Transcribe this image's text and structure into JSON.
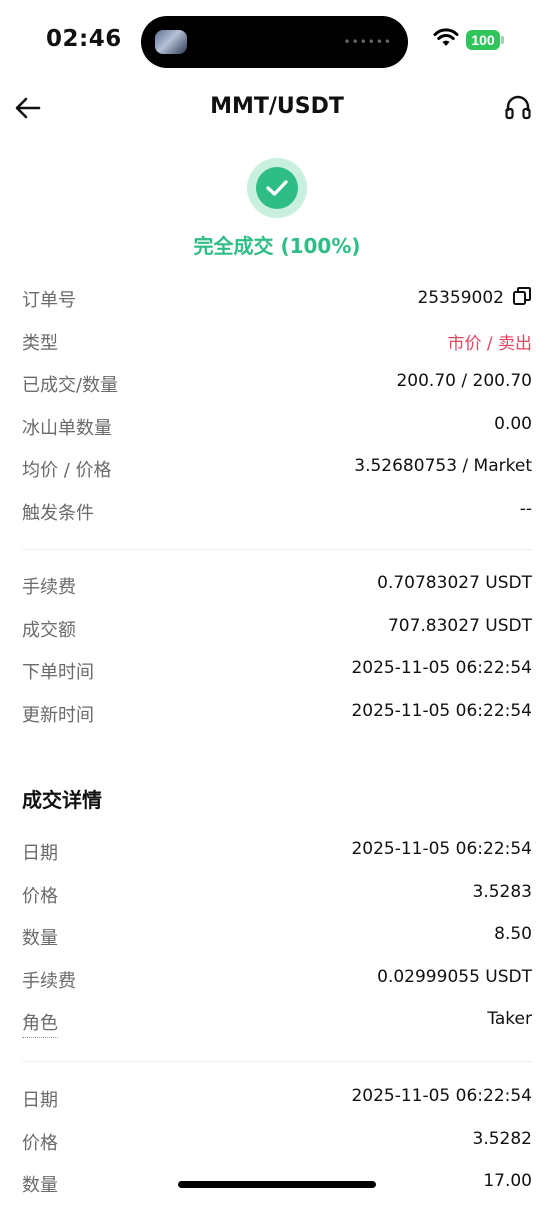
{
  "status_bar": {
    "time": "02:46",
    "battery": "100"
  },
  "nav": {
    "title": "MMT/USDT"
  },
  "order_status": {
    "text": "完全成交 (100%)"
  },
  "order_info": [
    {
      "label": "订单号",
      "value": "25359002"
    },
    {
      "label": "类型",
      "value": "市价 / 卖出"
    },
    {
      "label": "已成交/数量",
      "value": "200.70 / 200.70"
    },
    {
      "label": "冰山单数量",
      "value": "0.00"
    },
    {
      "label": "均价 / 价格",
      "value": "3.52680753 / Market"
    },
    {
      "label": "触发条件",
      "value": "--"
    }
  ],
  "fee_info": [
    {
      "label": "手续费",
      "value": "0.70783027 USDT"
    },
    {
      "label": "成交额",
      "value": "707.83027 USDT"
    },
    {
      "label": "下单时间",
      "value": "2025-11-05 06:22:54"
    },
    {
      "label": "更新时间",
      "value": "2025-11-05 06:22:54"
    }
  ],
  "trade_details": {
    "title": "成交详情",
    "trades": [
      [
        {
          "label": "日期",
          "value": "2025-11-05 06:22:54"
        },
        {
          "label": "价格",
          "value": "3.5283"
        },
        {
          "label": "数量",
          "value": "8.50"
        },
        {
          "label": "手续费",
          "value": "0.02999055 USDT"
        },
        {
          "label": "角色",
          "value": "Taker"
        }
      ],
      [
        {
          "label": "日期",
          "value": "2025-11-05 06:22:54"
        },
        {
          "label": "价格",
          "value": "3.5282"
        },
        {
          "label": "数量",
          "value": "17.00"
        }
      ]
    ]
  },
  "colors": {
    "success": "#2ebd85",
    "sell": "#e2465f",
    "battery": "#2fc55a"
  }
}
